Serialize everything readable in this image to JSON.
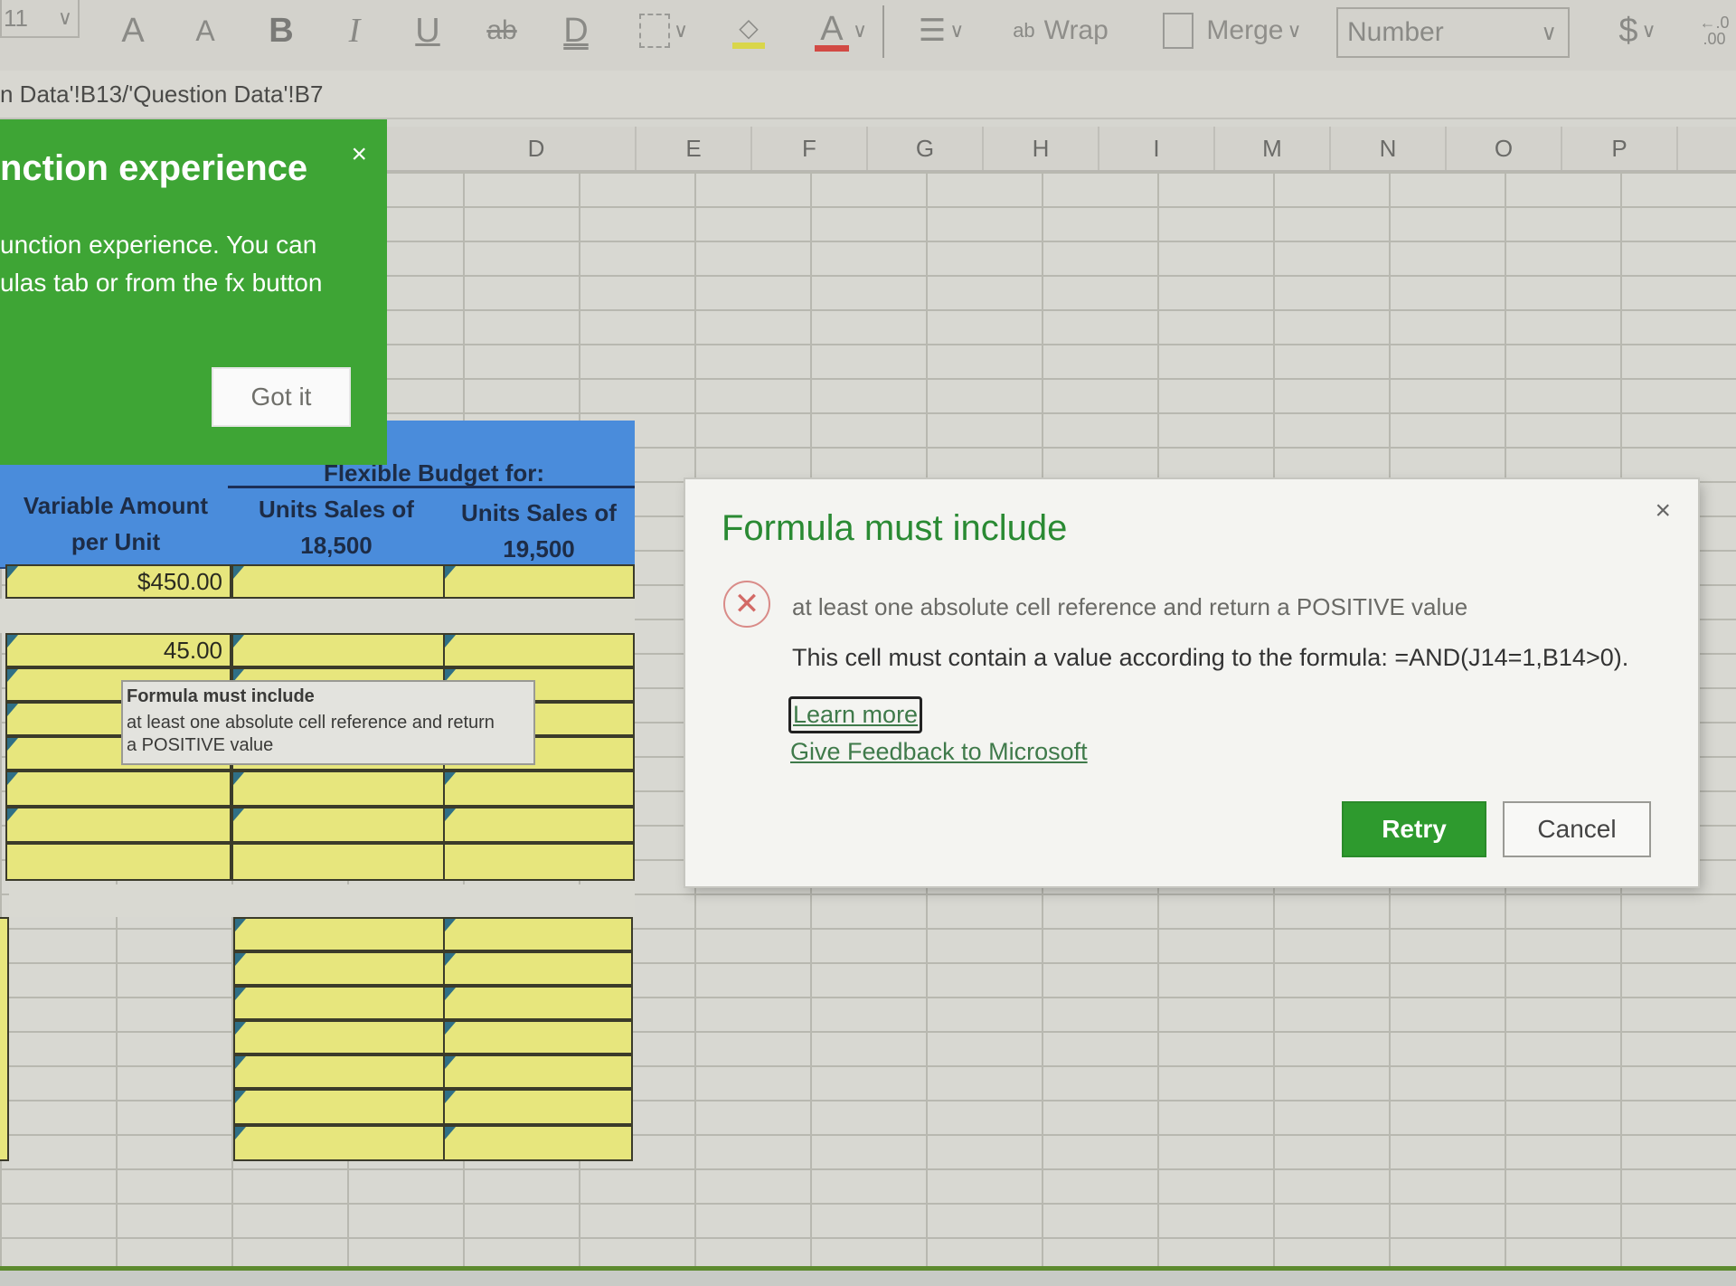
{
  "ribbon": {
    "font_size": "11",
    "grow_font_icon": "A",
    "shrink_font_icon": "A",
    "bold_icon": "B",
    "italic_icon": "I",
    "underline_icon": "U",
    "strikethrough_icon": "ab",
    "double_underline_icon": "D",
    "font_color_icon": "A",
    "wrap_label": "Wrap",
    "wrap_icon": "ab",
    "merge_label": "Merge",
    "number_format": "Number",
    "currency_icon": "$",
    "decimal_icon": "←.0 .00",
    "colors": {
      "highlight": "#d9d64a",
      "font_color": "#d24a44"
    }
  },
  "formula_bar": {
    "text": "n Data'!B13/'Question Data'!B7"
  },
  "columns": [
    "D",
    "E",
    "F",
    "G",
    "H",
    "I",
    "M",
    "N",
    "O",
    "P"
  ],
  "coachmark": {
    "title": "nction experience",
    "body_line1": "unction experience. You can",
    "body_line2": "ulas tab or from the fx button",
    "got_it": "Got it",
    "close": "×",
    "color": "#3ea535"
  },
  "table": {
    "flexible_budget_header": "Flexible Budget for:",
    "col_b_header_line1": "Variable Amount",
    "col_b_header_line2": "per Unit",
    "col_c_header_line1": "Units Sales of",
    "col_c_header_line2": "18,500",
    "col_d_header_line1": "Units Sales of",
    "col_d_header_line2": "19,500",
    "row1_value": "$450.00",
    "row2_value": "45.00",
    "header_color": "#4a8cdb",
    "cell_color": "#e7e67d"
  },
  "tooltip": {
    "title": "Formula must include",
    "line1": "at least one absolute cell reference and return",
    "line2": "a POSITIVE value"
  },
  "dialog": {
    "title": "Formula must include",
    "close": "×",
    "error_icon": "✕",
    "message1": "at least one absolute cell reference and return a POSITIVE value",
    "message2": "This cell must contain a value according to the formula: =AND(J14=1,B14>0).",
    "learn_more": "Learn more",
    "feedback": "Give Feedback to Microsoft",
    "retry": "Retry",
    "cancel": "Cancel",
    "accent": "#2e9a2e"
  }
}
